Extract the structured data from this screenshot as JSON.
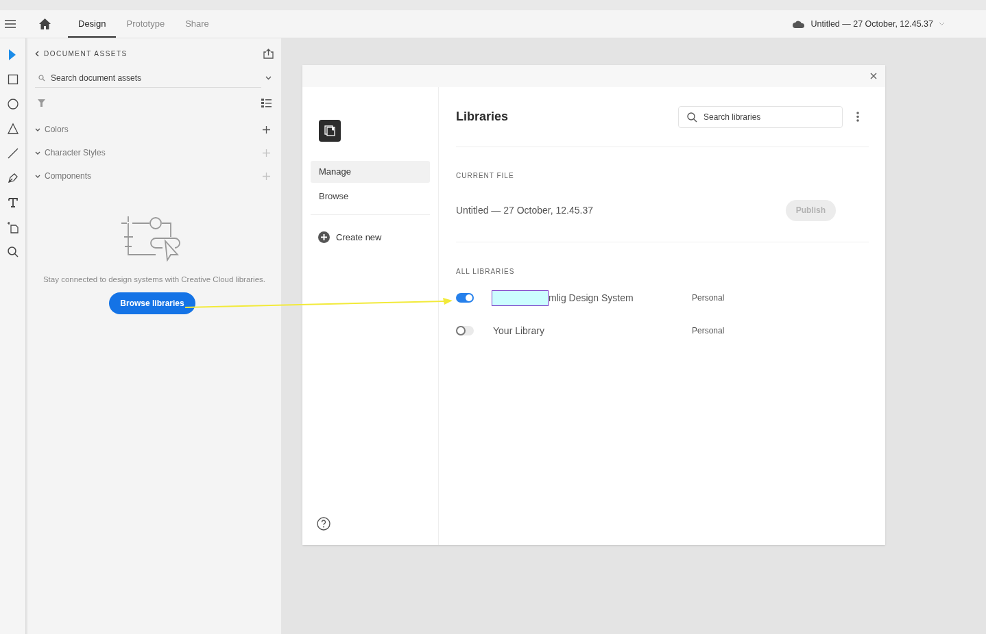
{
  "header": {
    "tabs": [
      {
        "label": "Design",
        "selected": true
      },
      {
        "label": "Prototype",
        "selected": false
      },
      {
        "label": "Share",
        "selected": false
      }
    ],
    "document_title": "Untitled — 27 October, 12.45.37"
  },
  "tools": [
    {
      "kind": "select",
      "selected": true
    },
    {
      "kind": "rectangle",
      "selected": false
    },
    {
      "kind": "ellipse",
      "selected": false
    },
    {
      "kind": "triangle",
      "selected": false
    },
    {
      "kind": "line",
      "selected": false
    },
    {
      "kind": "pen",
      "selected": false
    },
    {
      "kind": "text",
      "selected": false
    },
    {
      "kind": "artboard",
      "selected": false
    },
    {
      "kind": "zoom",
      "selected": false
    }
  ],
  "assets_panel": {
    "title": "DOCUMENT ASSETS",
    "search": {
      "placeholder": "Search document assets"
    },
    "sections": [
      {
        "label": "Colors",
        "add_enabled": true
      },
      {
        "label": "Character Styles",
        "add_enabled": false
      },
      {
        "label": "Components",
        "add_enabled": false
      }
    ],
    "empty_message": "Stay connected to design systems with Creative Cloud libraries.",
    "button": "Browse libraries"
  },
  "dialog": {
    "nav": [
      {
        "label": "Manage",
        "selected": true
      },
      {
        "label": "Browse",
        "selected": false
      }
    ],
    "create_new": "Create new",
    "title": "Libraries",
    "search": {
      "placeholder": "Search libraries"
    },
    "current_file_heading": "CURRENT FILE",
    "current_file": "Untitled — 27 October, 12.45.37",
    "publish_button": {
      "label": "Publish",
      "disabled": true
    },
    "all_libraries_heading": "ALL LIBRARIES",
    "libraries": [
      {
        "name": "mlig Design System",
        "owner": "Personal",
        "on": true,
        "redacted": true
      },
      {
        "name": "Your Library",
        "owner": "Personal",
        "on": false,
        "redacted": false
      }
    ]
  }
}
